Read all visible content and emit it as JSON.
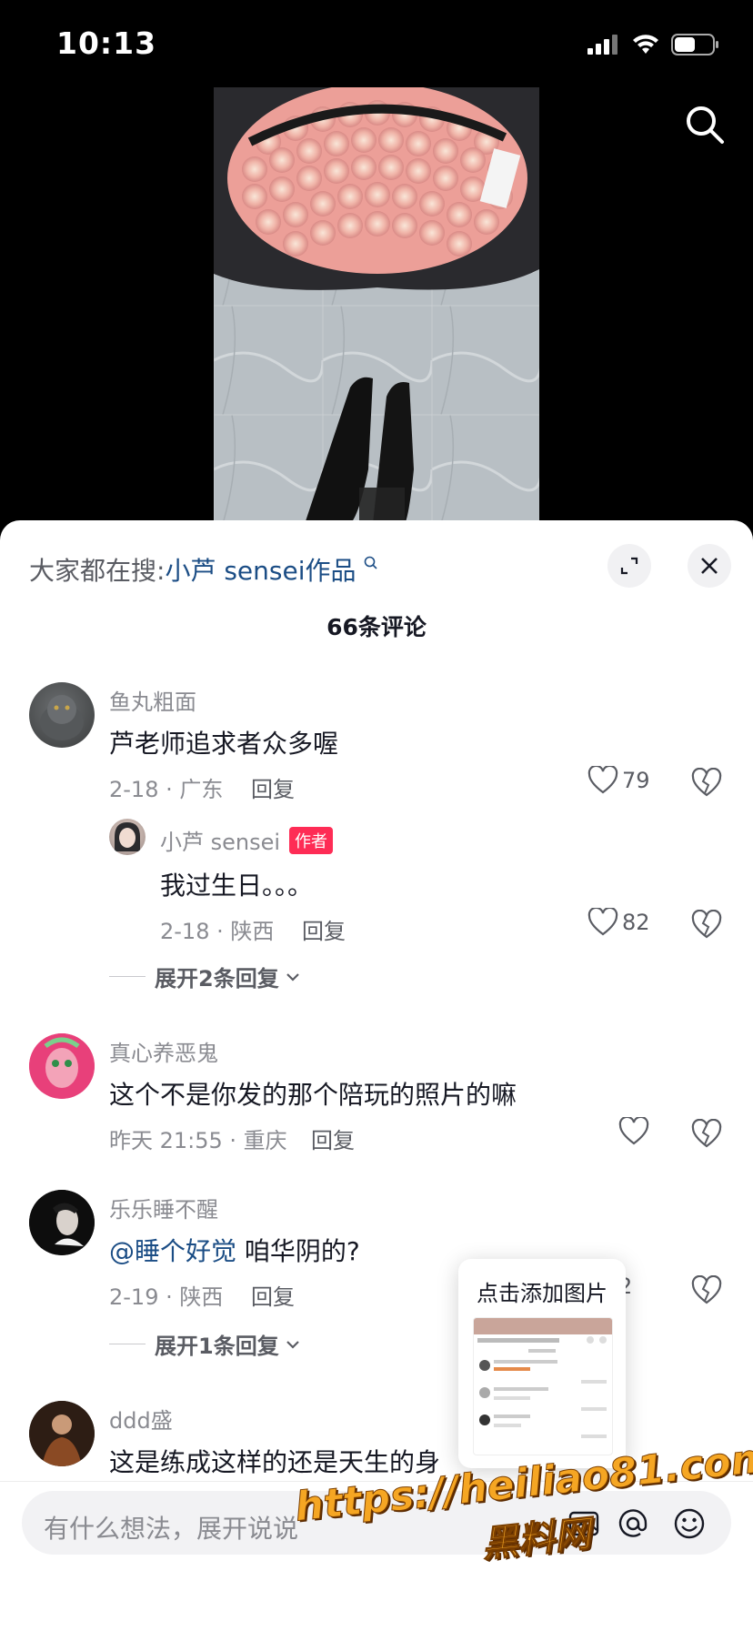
{
  "status_bar": {
    "time": "10:13"
  },
  "top_search_icon": "search-icon",
  "hot_search": {
    "prefix": "大家都在搜:",
    "keyword": "小芦 sensei作品"
  },
  "comment_count": "66条评论",
  "comments": [
    {
      "user": "鱼丸粗面",
      "text": "芦老师追求者众多喔",
      "meta": "2-18 · 广东",
      "reply": "回复",
      "likes": "79"
    },
    {
      "user": "小芦 sensei",
      "badge": "作者",
      "text": "我过生日。。。",
      "meta": "2-18 · 陕西",
      "reply": "回复",
      "likes": "82"
    },
    {
      "user": "真心养恶鬼",
      "text": "这个不是你发的那个陪玩的照片的嘛",
      "meta": "昨天 21:55 · 重庆",
      "reply": "回复",
      "likes": ""
    },
    {
      "user": "乐乐睡不醒",
      "mention": "@睡个好觉",
      "text": " 咱华阴的?",
      "meta": "2-19 · 陕西",
      "reply": "回复",
      "likes": "2"
    },
    {
      "user": "ddd盛",
      "text": "这是练成这样的还是天生的身",
      "meta": "",
      "reply": "",
      "likes": ""
    }
  ],
  "expand_replies": [
    "展开2条回复",
    "展开1条回复"
  ],
  "popover": {
    "title": "点击添加图片"
  },
  "input": {
    "placeholder": "有什么想法，展开说说"
  },
  "watermark": {
    "url": "https://heiliao81.com",
    "name": "黑料网"
  },
  "colors": {
    "accent": "#fe2c55",
    "link": "#1b4d85",
    "watermark": "#f5a623"
  }
}
